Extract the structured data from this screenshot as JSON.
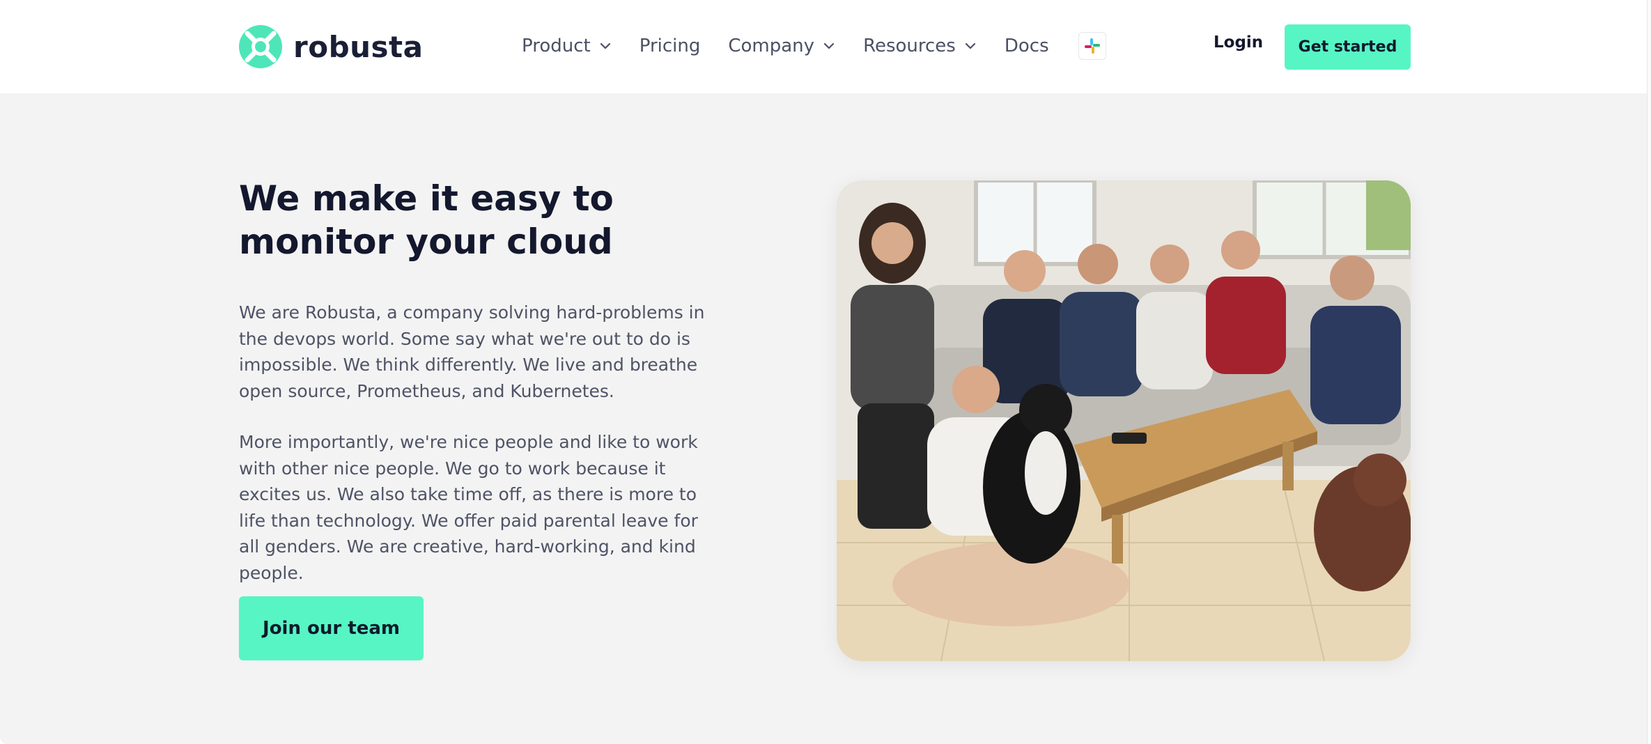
{
  "brand": {
    "name": "robusta",
    "accent_color": "#57f5c4",
    "logo_icon": "robusta-logo-icon"
  },
  "nav": {
    "items": [
      {
        "label": "Product",
        "has_dropdown": true
      },
      {
        "label": "Pricing",
        "has_dropdown": false
      },
      {
        "label": "Company",
        "has_dropdown": true
      },
      {
        "label": "Resources",
        "has_dropdown": true
      },
      {
        "label": "Docs",
        "has_dropdown": false
      }
    ],
    "slack_icon": "slack-icon"
  },
  "auth": {
    "login_label": "Login",
    "get_started_label": "Get started"
  },
  "hero": {
    "title": "We make it easy to monitor your cloud",
    "paragraph_1": "We are Robusta, a company solving hard-problems in the devops world. Some say what we're out to do is impossible. We think differently. We live and breathe open source, Prometheus, and Kubernetes.",
    "paragraph_2": "More importantly, we're nice people and like to work with other nice people. We go to work because it excites us. We also take time off, as there is more to life than technology. We offer paid parental leave for all genders. We are creative, hard-working, and kind people.",
    "cta_label": "Join our team",
    "image_subject": "team-photo"
  },
  "colors": {
    "hero_background": "#f3f3f3",
    "heading": "#14182e",
    "body_text": "#4f5366",
    "nav_text": "#4c5063"
  }
}
